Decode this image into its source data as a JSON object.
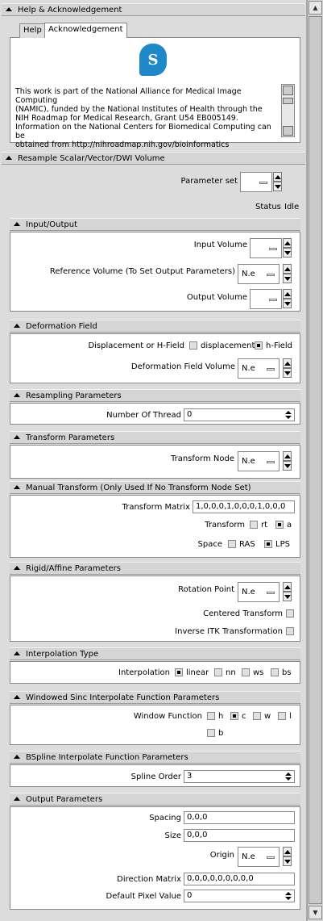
{
  "help": {
    "title": "Help & Acknowledgement",
    "tabs": [
      "Help",
      "Acknowledgement"
    ],
    "ack_lines": [
      "This work is part of the National Alliance for Medical Image Computing",
      "(NAMIC), funded by the National Institutes of Health through the",
      "NIH Roadmap for Medical Research, Grant U54 EB005149.",
      "Information on the National Centers for Biomedical Computing can be",
      "obtained from http://nihroadmap.nih.gov/bioinformatics"
    ],
    "logo_icon": "slicer-logo-icon"
  },
  "module": {
    "title": "Resample Scalar/Vector/DWI Volume",
    "parameter_set_label": "Parameter set",
    "status_label": "Status",
    "status_value": "Idle"
  },
  "sections": {
    "io": {
      "title": "Input/Output",
      "input_volume": "Input Volume",
      "reference_volume": "Reference Volume (To Set Output Parameters)",
      "reference_value": "N.e",
      "output_volume": "Output Volume"
    },
    "deformation": {
      "title": "Deformation Field",
      "mode_label": "Displacement or H-Field",
      "opt_displacement": "displacement",
      "opt_hfield": "h-Field",
      "field_volume": "Deformation Field Volume",
      "field_value": "N.e"
    },
    "resampling": {
      "title": "Resampling Parameters",
      "threads_label": "Number Of Thread",
      "threads_value": "0"
    },
    "transform": {
      "title": "Transform Parameters",
      "node_label": "Transform Node",
      "node_value": "N.e"
    },
    "manual": {
      "title": "Manual Transform (Only Used If No Transform Node Set)",
      "matrix_label": "Transform Matrix",
      "matrix_value": "1,0,0,0,1,0,0,0,1,0,0,0",
      "transform_label": "Transform",
      "opt_rt": "rt",
      "opt_a": "a",
      "space_label": "Space",
      "opt_ras": "RAS",
      "opt_lps": "LPS"
    },
    "rigid": {
      "title": "Rigid/Affine Parameters",
      "rotation_label": "Rotation Point",
      "rotation_value": "N.e",
      "centered_label": "Centered Transform",
      "inverse_label": "Inverse ITK Transformation"
    },
    "interp": {
      "title": "Interpolation Type",
      "label": "Interpolation",
      "opt_linear": "linear",
      "opt_nn": "nn",
      "opt_ws": "ws",
      "opt_bs": "bs"
    },
    "windowed": {
      "title": "Windowed Sinc Interpolate Function Parameters",
      "label": "Window Function",
      "opt_h": "h",
      "opt_c": "c",
      "opt_w": "w",
      "opt_l": "l",
      "opt_b": "b"
    },
    "bspline": {
      "title": "BSpline Interpolate Function Parameters",
      "order_label": "Spline Order",
      "order_value": "3"
    },
    "output": {
      "title": "Output Parameters",
      "spacing_label": "Spacing",
      "spacing_value": "0,0,0",
      "size_label": "Size",
      "size_value": "0,0,0",
      "origin_label": "Origin",
      "origin_value": "N.e",
      "direction_label": "Direction Matrix",
      "direction_value": "0,0,0,0,0,0,0,0,0",
      "pixel_label": "Default Pixel Value",
      "pixel_value": "0"
    }
  }
}
